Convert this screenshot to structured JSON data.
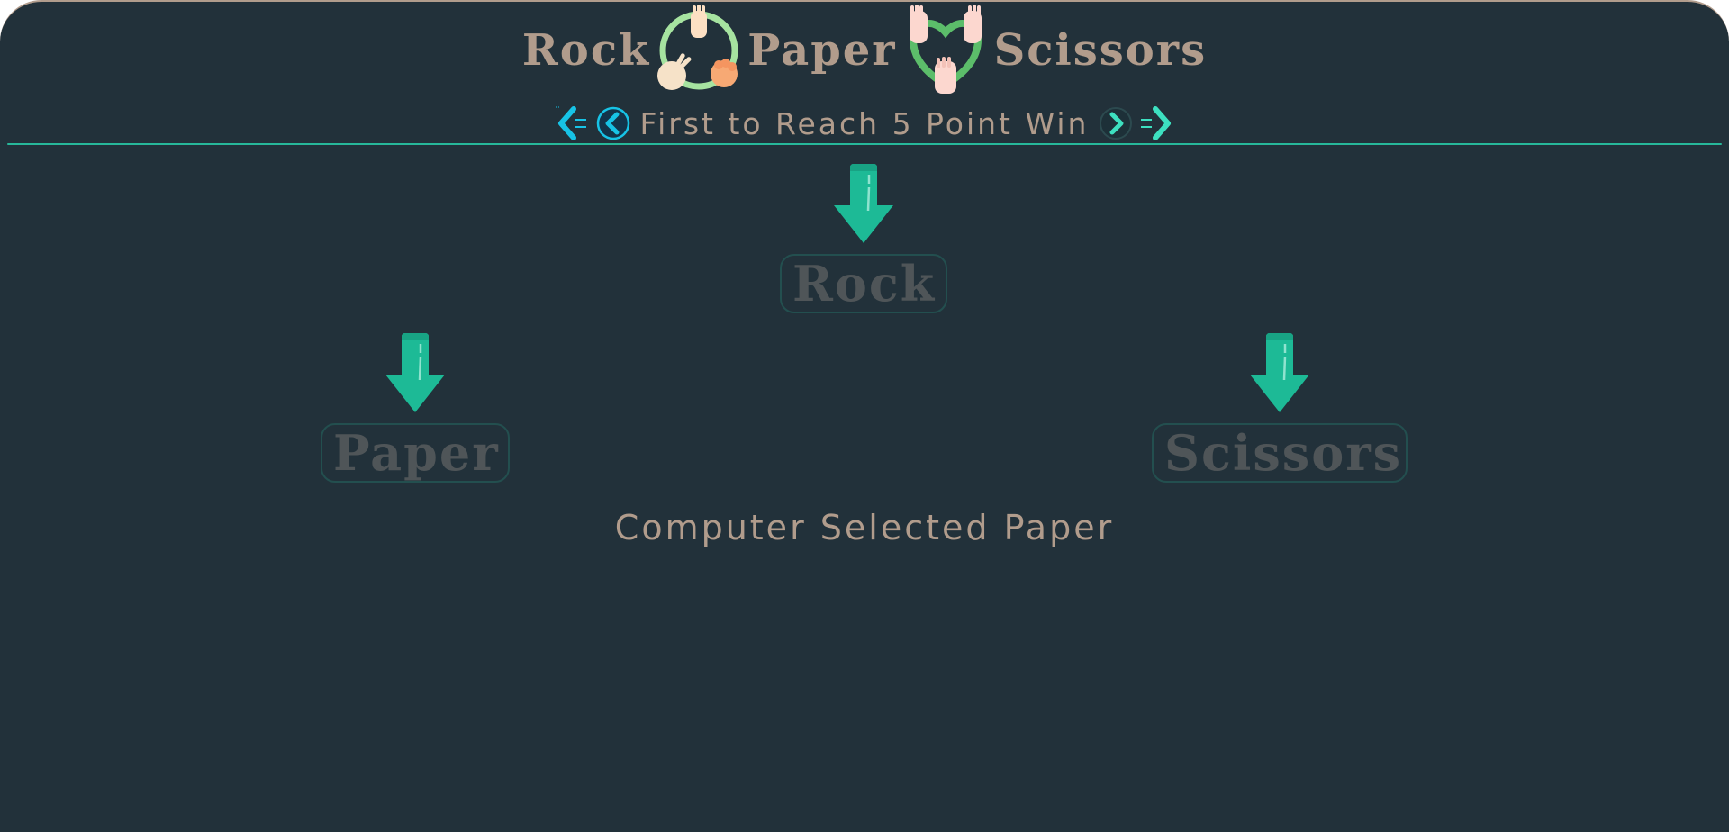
{
  "header": {
    "title_words": [
      "Rock",
      "Paper",
      "Scissors"
    ],
    "subtitle": "First to Reach 5 Point Win",
    "icons": [
      "rps-cycle-icon",
      "hands-heart-icon",
      "double-chevron-left-icon",
      "circle-chevron-left-icon",
      "circle-chevron-right-icon",
      "double-chevron-right-icon"
    ]
  },
  "choices": {
    "rock": "Rock",
    "paper": "Paper",
    "scissors": "Scissors"
  },
  "result": "Computer Selected Paper",
  "colors": {
    "background": "#22313a",
    "accent": "#1dba96",
    "title_text": "#b19c8c",
    "button_text": "#4f5558",
    "button_border": "#234f4f",
    "nav_cyan": "#17c3e6"
  }
}
